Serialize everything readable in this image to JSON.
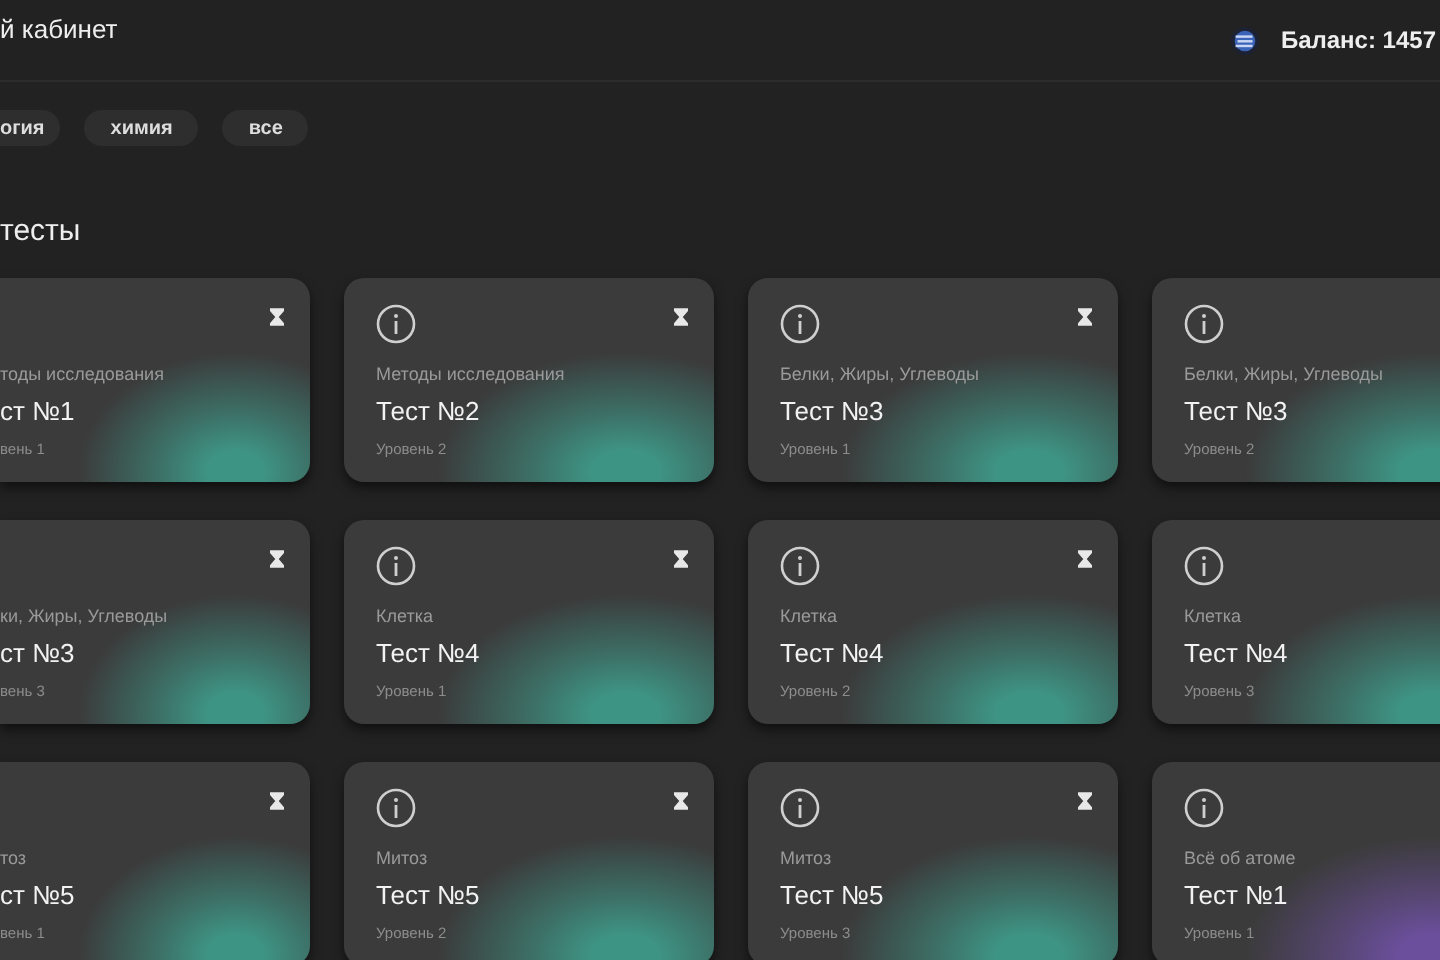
{
  "header": {
    "title": "й кабинет",
    "balance": "Баланс: 1457"
  },
  "filters": [
    {
      "label": "огия",
      "kind": "clipped"
    },
    {
      "label": "химия",
      "kind": "full"
    },
    {
      "label": "все",
      "kind": "full"
    }
  ],
  "section_title": "тесты",
  "cards": [
    {
      "kind": "clipped",
      "topic": "тоды исследования",
      "title": "ст №1",
      "level": "вень 1",
      "hourglass": true,
      "color": "#3e9484"
    },
    {
      "kind": "full",
      "topic": "Методы исследования",
      "title": "Тест №2",
      "level": "Уровень 2",
      "hourglass": true,
      "color": "#3e9484"
    },
    {
      "kind": "full",
      "topic": "Белки, Жиры, Углеводы",
      "title": "Тест №3",
      "level": "Уровень 1",
      "hourglass": true,
      "color": "#3e9484"
    },
    {
      "kind": "full",
      "topic": "Белки, Жиры, Углеводы",
      "title": "Тест №3",
      "level": "Уровень 2",
      "color": "#3e9484"
    },
    {
      "kind": "clipped",
      "topic": "ки, Жиры, Углеводы",
      "title": "ст №3",
      "level": "вень 3",
      "hourglass": true,
      "color": "#3e9484"
    },
    {
      "kind": "full",
      "topic": "Клетка",
      "title": "Тест №4",
      "level": "Уровень 1",
      "hourglass": true,
      "color": "#3e9484"
    },
    {
      "kind": "full",
      "topic": "Клетка",
      "title": "Тест №4",
      "level": "Уровень 2",
      "hourglass": true,
      "color": "#3e9484"
    },
    {
      "kind": "full",
      "topic": "Клетка",
      "title": "Тест №4",
      "level": "Уровень 3",
      "color": "#3e9484"
    },
    {
      "kind": "clipped",
      "topic": "тоз",
      "title": "ст №5",
      "level": "вень 1",
      "hourglass": true,
      "color": "#3e9484"
    },
    {
      "kind": "full",
      "topic": "Митоз",
      "title": "Тест №5",
      "level": "Уровень 2",
      "hourglass": true,
      "color": "#3e9484"
    },
    {
      "kind": "full",
      "topic": "Митоз",
      "title": "Тест №5",
      "level": "Уровень 3",
      "hourglass": true,
      "color": "#3e9484"
    },
    {
      "kind": "full",
      "topic": "Всё об атоме",
      "title": "Тест №1",
      "level": "Уровень 1",
      "color": "#6b4f9c"
    }
  ]
}
